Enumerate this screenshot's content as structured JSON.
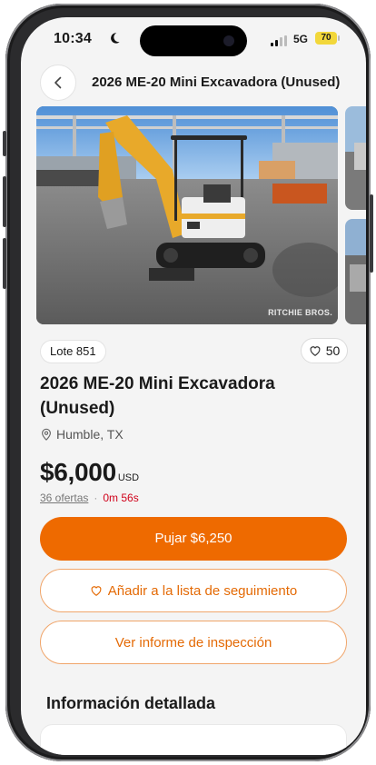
{
  "status_bar": {
    "time": "10:34",
    "network": "5G",
    "battery": "70"
  },
  "header": {
    "title": "2026 ME-20 Mini Excavadora (Unused)"
  },
  "gallery": {
    "watermark": "RITCHIE BROS."
  },
  "listing": {
    "lot": "Lote 851",
    "likes": "50",
    "title": "2026 ME-20 Mini Excavadora (Unused)",
    "location": "Humble, TX",
    "price": "$6,000",
    "currency": "USD",
    "bids": "36 ofertas",
    "separator": "·",
    "time_left": "0m 56s"
  },
  "actions": {
    "bid": "Pujar $6,250",
    "watchlist": "Añadir a la lista de seguimiento",
    "inspection": "Ver informe de inspección"
  },
  "details": {
    "section_title": "Información detallada"
  },
  "colors": {
    "accent": "#ee6a00",
    "accent_text": "#e46a05",
    "timer": "#d0021b",
    "battery": "#f2d73a"
  },
  "icons": [
    "moon-icon",
    "signal-icon",
    "back-chevron-icon",
    "heart-icon",
    "location-pin-icon"
  ]
}
